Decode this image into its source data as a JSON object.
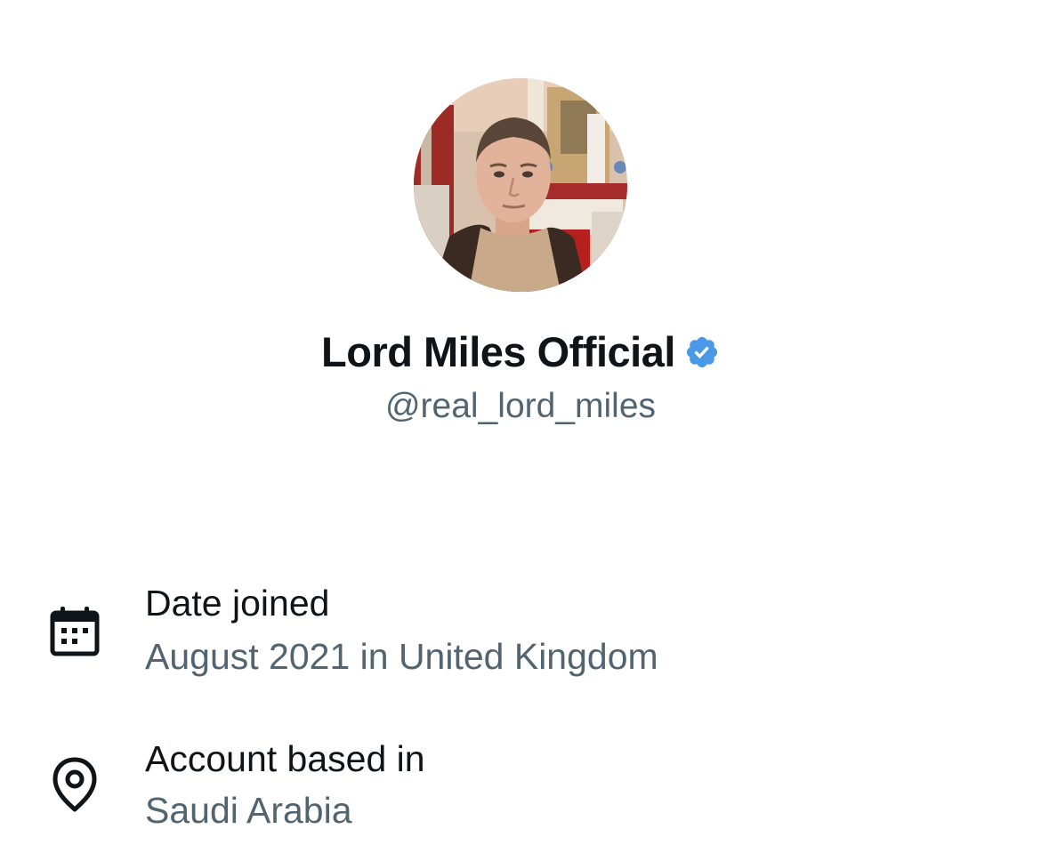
{
  "profile": {
    "display_name": "Lord Miles Official",
    "handle": "@real_lord_miles",
    "verified": true,
    "verified_color": "#4a99e9"
  },
  "about": {
    "items": [
      {
        "icon": "calendar-icon",
        "label": "Date joined",
        "value": "August 2021 in United Kingdom"
      },
      {
        "icon": "location-pin-icon",
        "label": "Account based in",
        "value": "Saudi Arabia"
      }
    ]
  },
  "colors": {
    "primary_text": "#0f1419",
    "secondary_text": "#536471",
    "background": "#ffffff"
  }
}
